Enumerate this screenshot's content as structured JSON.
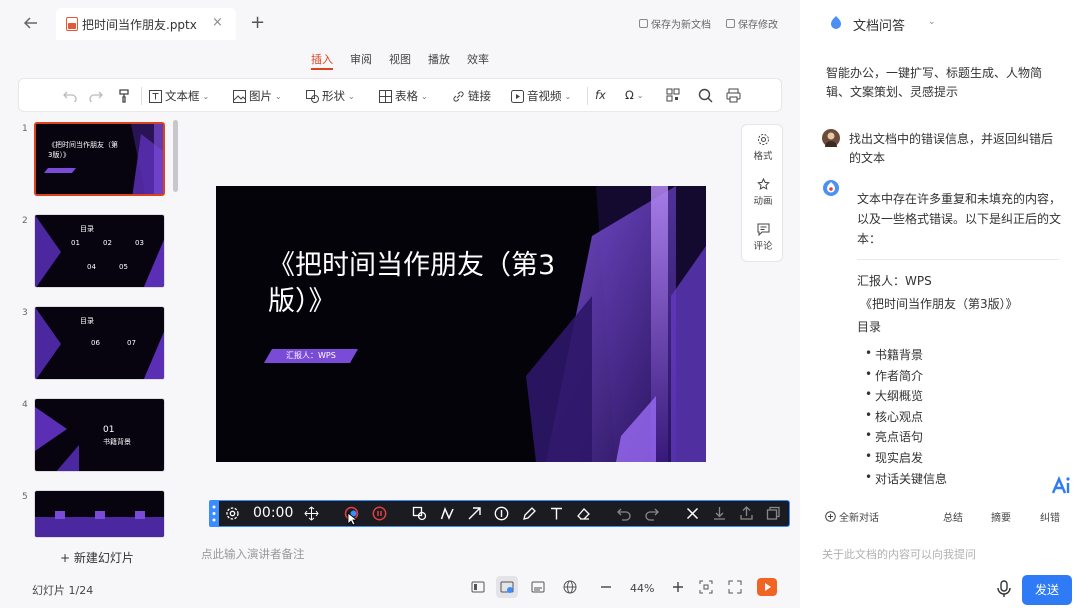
{
  "tab": {
    "title": "把时间当作朋友.pptx",
    "close": "×",
    "new": "+"
  },
  "top_actions": [
    "保存为新文档",
    "保存修改"
  ],
  "ribbon": {
    "menus": [
      "插入",
      "审阅",
      "视图",
      "播放",
      "效率"
    ],
    "active": "插入"
  },
  "toolbar": {
    "textbox": "文本框",
    "picture": "图片",
    "shape": "形状",
    "table": "表格",
    "link": "链接",
    "media": "音视频",
    "formula": "fx",
    "symbol": "Ω"
  },
  "thumbnails": [
    {
      "num": "1",
      "lines": [
        "《把时间当作朋友（第",
        "3版）》"
      ]
    },
    {
      "num": "2",
      "lines": [
        "目录",
        "01",
        "02",
        "03",
        "04",
        "05"
      ]
    },
    {
      "num": "3",
      "lines": [
        "目录",
        "06",
        "07"
      ]
    },
    {
      "num": "4",
      "lines": [
        "01",
        "书籍背景"
      ]
    },
    {
      "num": "5",
      "lines": []
    }
  ],
  "new_slide": "+ 新建幻灯片",
  "slide": {
    "title": "《把时间当作朋友（第3版）》",
    "badge": "汇报人：WPS"
  },
  "side_tools": [
    "格式",
    "动画",
    "评论"
  ],
  "presenter": {
    "time": "00:00"
  },
  "notes_placeholder": "点此输入演讲者备注",
  "status": {
    "slide_counter": "幻灯片 1/24",
    "zoom": "44%"
  },
  "ai_panel": {
    "title": "文档问答",
    "intro": "智能办公，一键扩写、标题生成、人物简辑、文案策划、灵感提示",
    "user_message": "找出文档中的错误信息，并返回纠错后的文本",
    "bot_message": "文本中存在许多重复和未填充的内容，以及一些格式错误。以下是纠正后的文本：",
    "bot_lines": [
      "汇报人：WPS",
      "《把时间当作朋友（第3版）》",
      "目录"
    ],
    "bullets": [
      "书籍背景",
      "作者简介",
      "大纲概览",
      "核心观点",
      "亮点语句",
      "现实启发",
      "对话关键信息"
    ],
    "actions": [
      "全新对话",
      "总结",
      "摘要",
      "纠错"
    ],
    "input_placeholder": "关于此文档的内容可以向我提问",
    "send": "发送"
  },
  "colors": {
    "accent": "#d9431e",
    "send_button": "#2f7bf5",
    "slide_background": "#05030a",
    "slide_purple": "#7a4bd6"
  }
}
